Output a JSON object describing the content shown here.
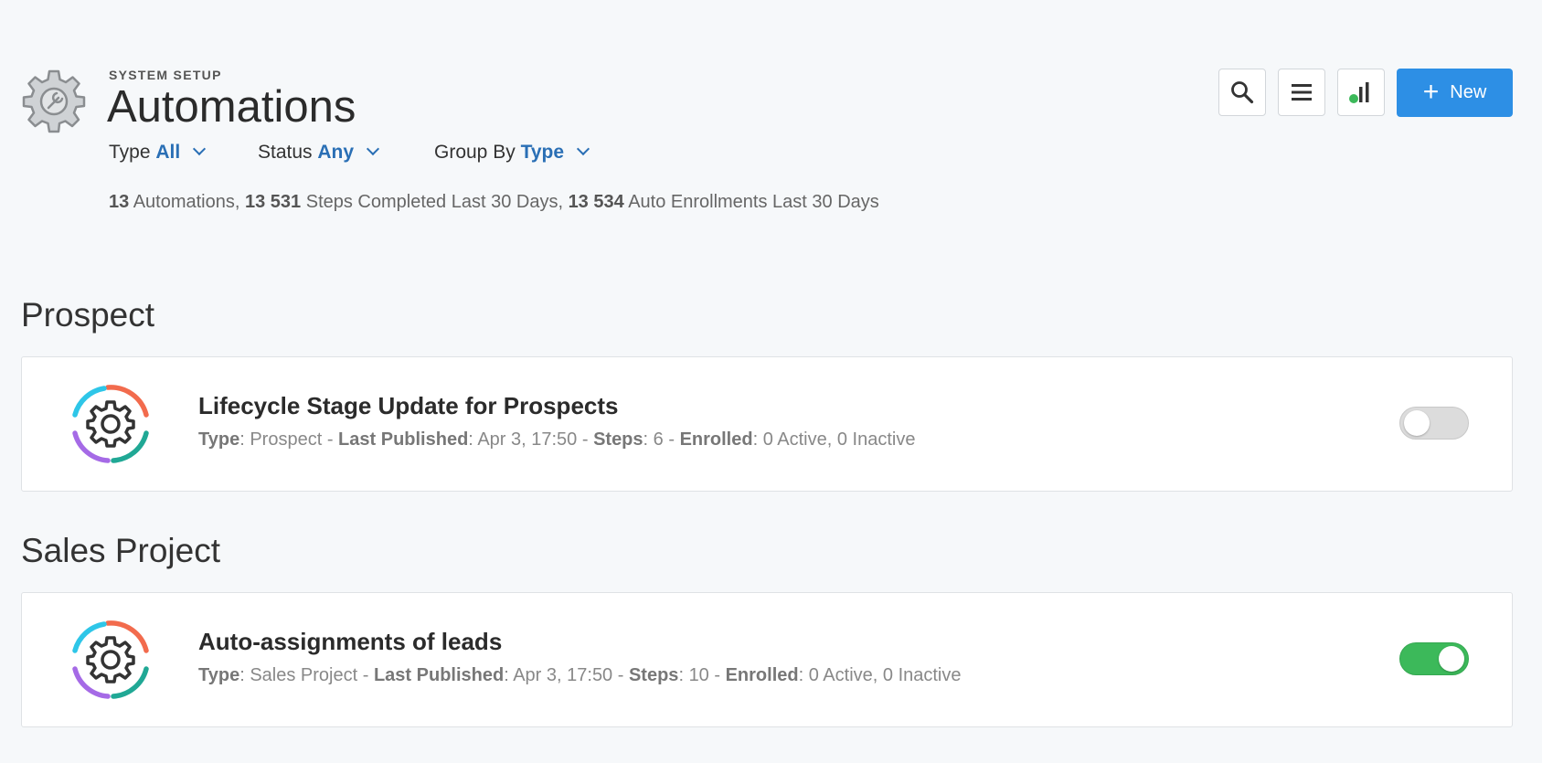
{
  "header": {
    "kicker": "SYSTEM SETUP",
    "title": "Automations"
  },
  "filters": [
    {
      "label": "Type",
      "value": "All"
    },
    {
      "label": "Status",
      "value": "Any"
    },
    {
      "label": "Group By",
      "value": "Type"
    }
  ],
  "stats": {
    "automations_count": "13",
    "automations_label": "Automations,",
    "steps_count": "13 531",
    "steps_label": "Steps Completed Last 30 Days,",
    "enroll_count": "13 534",
    "enroll_label": "Auto Enrollments Last 30 Days"
  },
  "toolbar": {
    "new_label": "New",
    "status_dot_color": "#3cb95a",
    "accent": "#2d8fe5"
  },
  "groups": [
    {
      "title": "Prospect",
      "items": [
        {
          "name": "Lifecycle Stage Update for Prospects",
          "type_label": "Type",
          "type": "Prospect",
          "published_label": "Last Published",
          "published": "Apr 3, 17:50",
          "steps_label": "Steps",
          "steps": "6",
          "enrolled_label": "Enrolled",
          "enrolled": "0 Active, 0 Inactive",
          "enabled": false
        }
      ]
    },
    {
      "title": "Sales Project",
      "items": [
        {
          "name": "Auto-assignments of leads",
          "type_label": "Type",
          "type": "Sales Project",
          "published_label": "Last Published",
          "published": "Apr 3, 17:50",
          "steps_label": "Steps",
          "steps": "10",
          "enrolled_label": "Enrolled",
          "enrolled": "0 Active, 0 Inactive",
          "enabled": true
        }
      ]
    }
  ]
}
